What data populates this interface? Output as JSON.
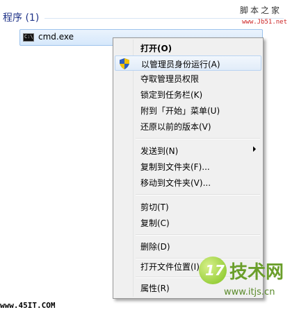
{
  "programs_header": "程序 (1)",
  "result": {
    "icon_label": "C:\\",
    "name": "cmd.exe"
  },
  "menu": {
    "items": [
      {
        "label": "打开(O)",
        "bold": true
      },
      {
        "label": "以管理员身份运行(A)",
        "highlighted": true,
        "icon": "uac-shield-icon"
      },
      {
        "label": "夺取管理员权限"
      },
      {
        "label": "锁定到任务栏(K)"
      },
      {
        "label": "附到「开始」菜单(U)"
      },
      {
        "label": "还原以前的版本(V)"
      },
      {
        "label": "发送到(N)",
        "submenu": true
      },
      {
        "label": "复制到文件夹(F)..."
      },
      {
        "label": "移动到文件夹(V)..."
      },
      {
        "label": "剪切(T)"
      },
      {
        "label": "复制(C)"
      },
      {
        "label": "删除(D)"
      },
      {
        "label": "打开文件位置(I)"
      },
      {
        "label": "属性(R)"
      }
    ]
  },
  "watermarks": {
    "top_right_title": "脚本之家",
    "top_right_url": "www.Jb51.net",
    "bottom_left": "www.45IT.COM",
    "bottom_right_logo": "17",
    "bottom_right_title": "技术网",
    "bottom_right_url": "www.itjs.cn"
  },
  "colors": {
    "header_text": "#1e3287",
    "menu_bg": "#f0f0f0",
    "highlight_border": "#b8d3f2"
  }
}
